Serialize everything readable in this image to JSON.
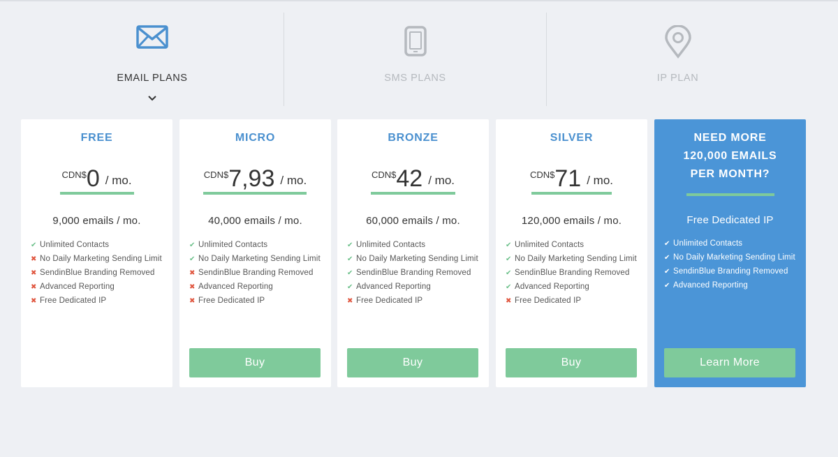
{
  "tabs": [
    {
      "label": "EMAIL PLANS",
      "icon": "envelope-icon",
      "active": true
    },
    {
      "label": "SMS PLANS",
      "icon": "mobile-phone-icon",
      "active": false
    },
    {
      "label": "IP PLAN",
      "icon": "location-pin-icon",
      "active": false
    }
  ],
  "colors": {
    "accent_blue": "#4a90cf",
    "card_blue": "#4b95d7",
    "accent_green": "#7fca9b",
    "check_green": "#6cc08a",
    "cross_red": "#e0563f",
    "background": "#eef0f4"
  },
  "plans": [
    {
      "name": "FREE",
      "currency": "CDN$",
      "amount": "0",
      "per": "/ mo.",
      "emails": "9,000 emails / mo.",
      "features": [
        {
          "label": "Unlimited Contacts",
          "included": true
        },
        {
          "label": "No Daily Marketing Sending Limit",
          "included": false
        },
        {
          "label": "SendinBlue Branding Removed",
          "included": false
        },
        {
          "label": "Advanced Reporting",
          "included": false
        },
        {
          "label": "Free Dedicated IP",
          "included": false
        }
      ]
    },
    {
      "name": "MICRO",
      "currency": "CDN$",
      "amount": "7,93",
      "per": "/ mo.",
      "emails": "40,000 emails / mo.",
      "button": "Buy",
      "features": [
        {
          "label": "Unlimited Contacts",
          "included": true
        },
        {
          "label": "No Daily Marketing Sending Limit",
          "included": true
        },
        {
          "label": "SendinBlue Branding Removed",
          "included": false
        },
        {
          "label": "Advanced Reporting",
          "included": false
        },
        {
          "label": "Free Dedicated IP",
          "included": false
        }
      ]
    },
    {
      "name": "BRONZE",
      "currency": "CDN$",
      "amount": "42",
      "per": "/ mo.",
      "emails": "60,000 emails / mo.",
      "button": "Buy",
      "features": [
        {
          "label": "Unlimited Contacts",
          "included": true
        },
        {
          "label": "No Daily Marketing Sending Limit",
          "included": true
        },
        {
          "label": "SendinBlue Branding Removed",
          "included": true
        },
        {
          "label": "Advanced Reporting",
          "included": true
        },
        {
          "label": "Free Dedicated IP",
          "included": false
        }
      ]
    },
    {
      "name": "SILVER",
      "currency": "CDN$",
      "amount": "71",
      "per": "/ mo.",
      "emails": "120,000 emails / mo.",
      "button": "Buy",
      "features": [
        {
          "label": "Unlimited Contacts",
          "included": true
        },
        {
          "label": "No Daily Marketing Sending Limit",
          "included": true
        },
        {
          "label": "SendinBlue Branding Removed",
          "included": true
        },
        {
          "label": "Advanced Reporting",
          "included": true
        },
        {
          "label": "Free Dedicated IP",
          "included": false
        }
      ]
    }
  ],
  "enterprise": {
    "title_lines": [
      "NEED MORE",
      "120,000 EMAILS",
      "PER MONTH?"
    ],
    "subtitle": "Free Dedicated IP",
    "button": "Learn More",
    "features": [
      {
        "label": "Unlimited Contacts",
        "included": true
      },
      {
        "label": "No Daily Marketing Sending Limit",
        "included": true
      },
      {
        "label": "SendinBlue Branding Removed",
        "included": true
      },
      {
        "label": "Advanced Reporting",
        "included": true
      }
    ]
  }
}
